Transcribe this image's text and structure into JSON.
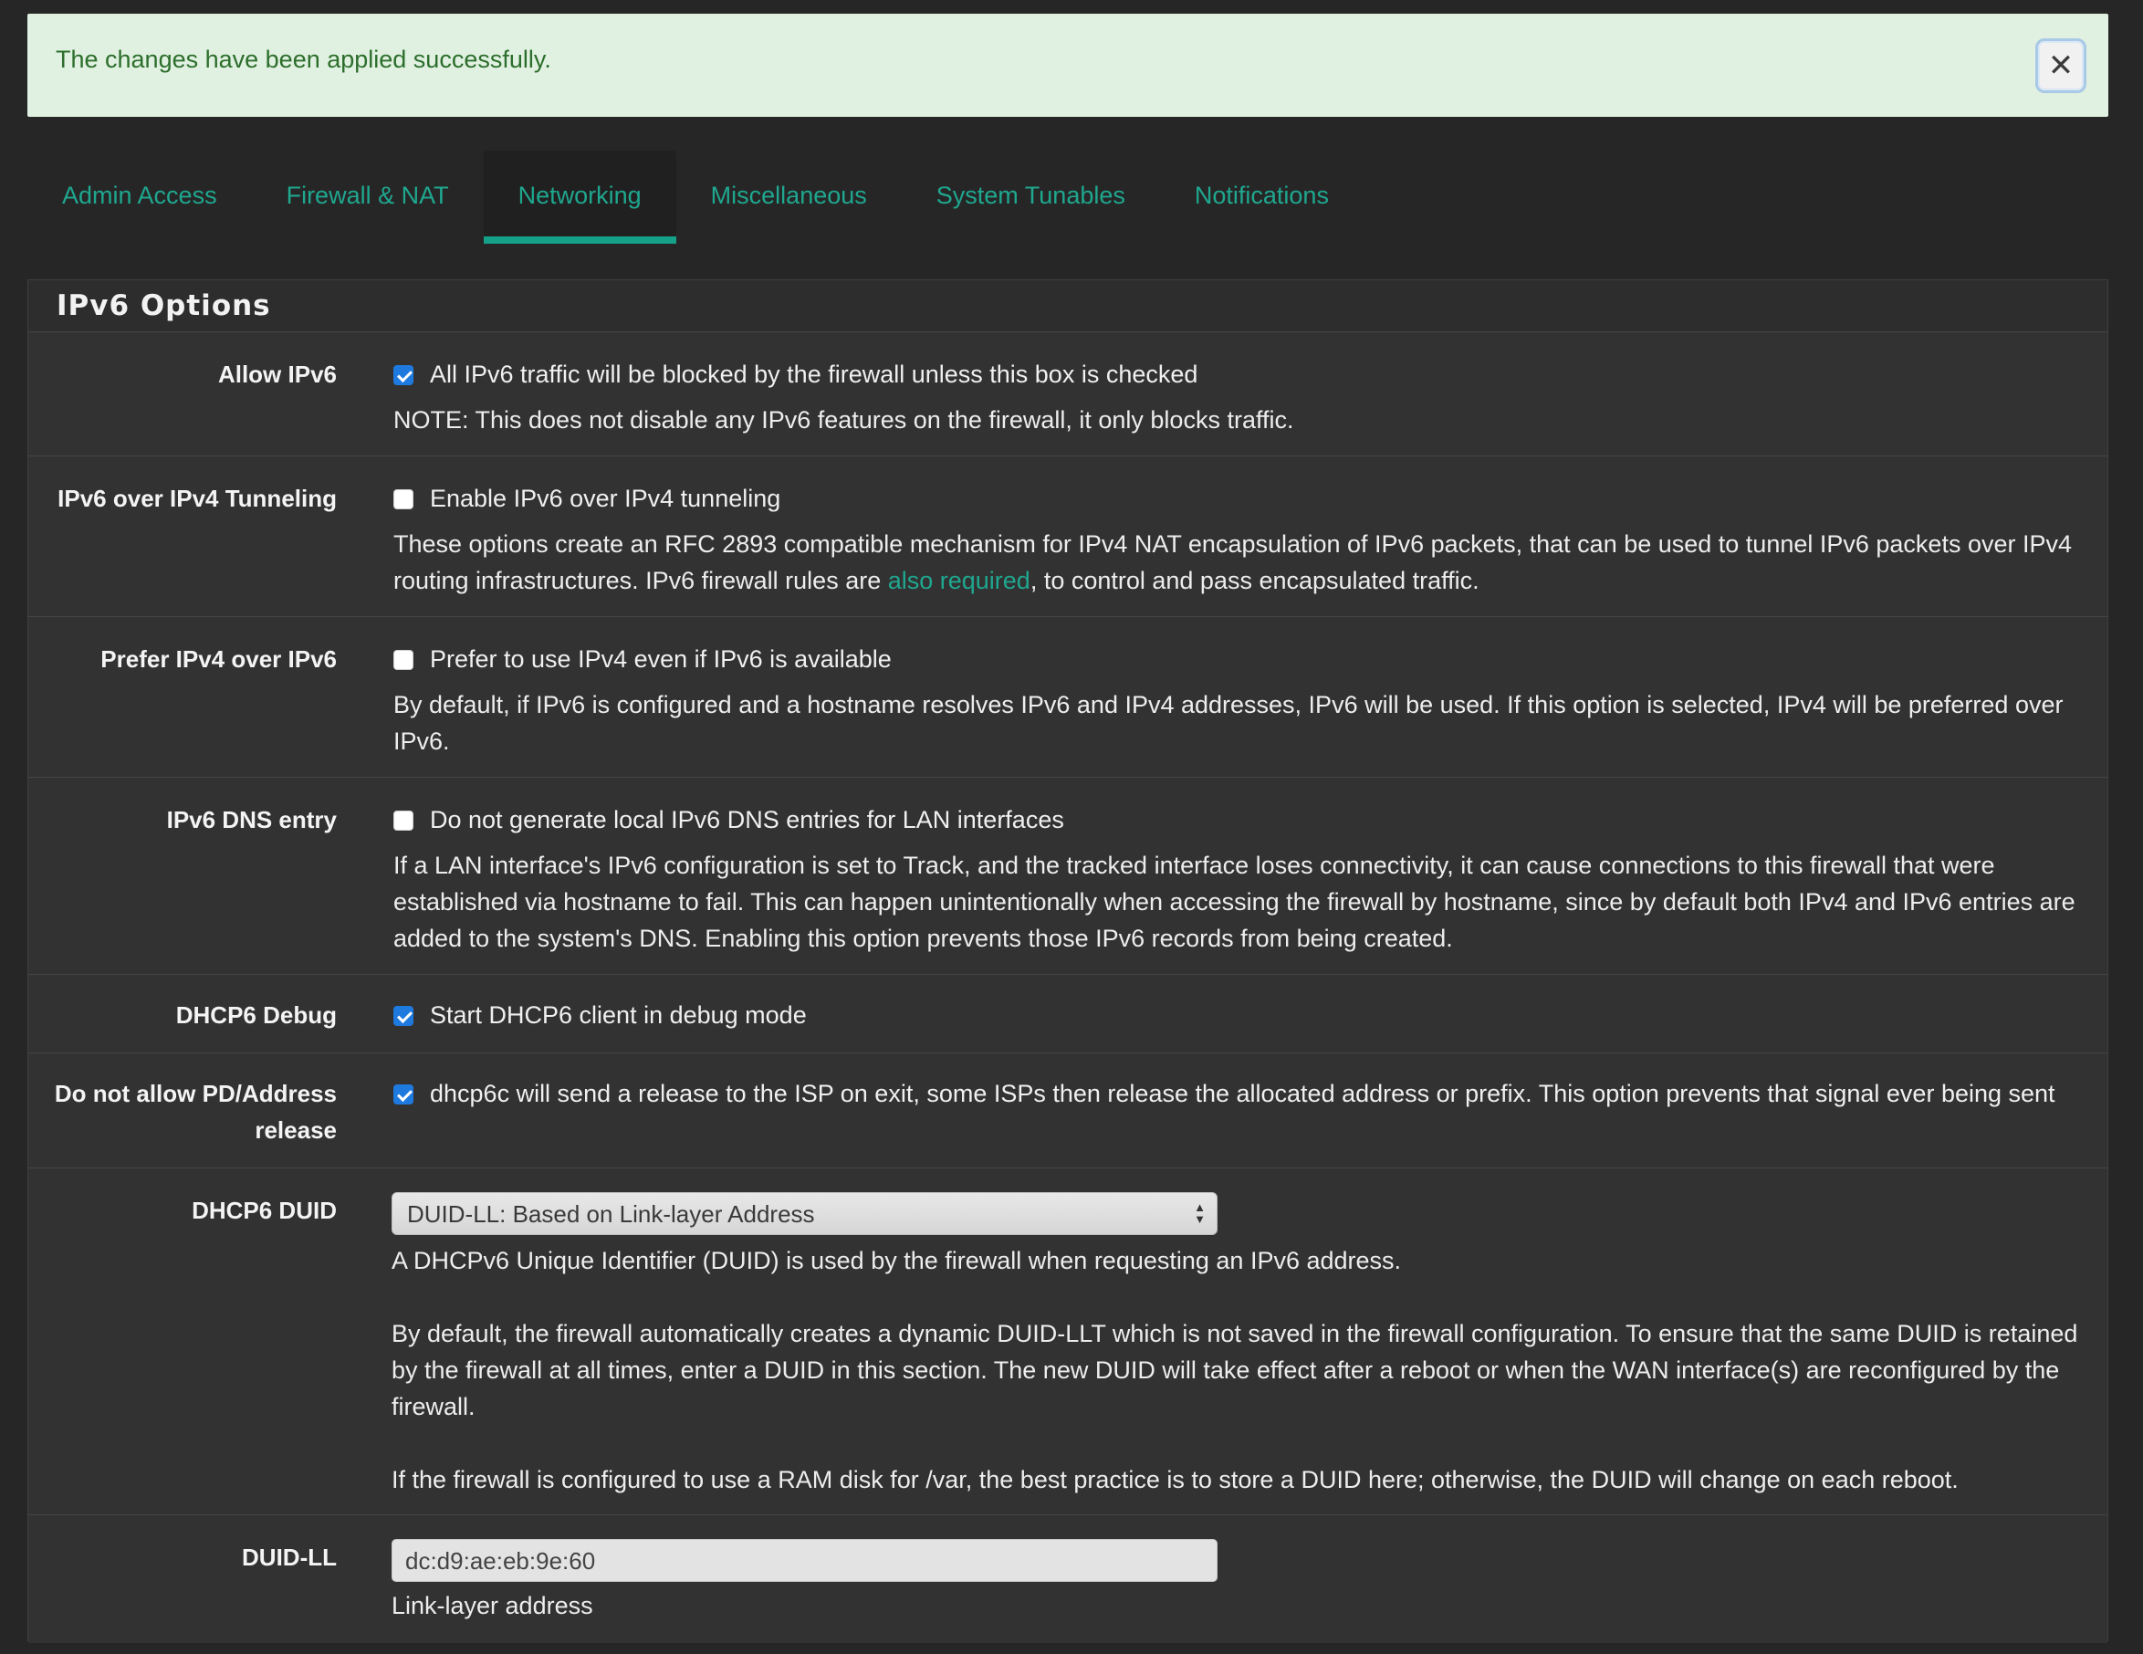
{
  "alert": {
    "message": "The changes have been applied successfully.",
    "close_symbol": "✕"
  },
  "tabs": [
    {
      "label": "Admin Access",
      "active": false
    },
    {
      "label": "Firewall & NAT",
      "active": false
    },
    {
      "label": "Networking",
      "active": true
    },
    {
      "label": "Miscellaneous",
      "active": false
    },
    {
      "label": "System Tunables",
      "active": false
    },
    {
      "label": "Notifications",
      "active": false
    }
  ],
  "panel": {
    "title": "IPv6 Options"
  },
  "rows": {
    "allow_ipv6": {
      "label": "Allow IPv6",
      "checked": true,
      "checkbox_text": "All IPv6 traffic will be blocked by the firewall unless this box is checked",
      "help": "NOTE: This does not disable any IPv6 features on the firewall, it only blocks traffic."
    },
    "tunneling": {
      "label": "IPv6 over IPv4 Tunneling",
      "checked": false,
      "checkbox_text": "Enable IPv6 over IPv4 tunneling",
      "help_before": "These options create an RFC 2893 compatible mechanism for IPv4 NAT encapsulation of IPv6 packets, that can be used to tunnel IPv6 packets over IPv4 routing infrastructures. IPv6 firewall rules are ",
      "help_link": "also required",
      "help_after": ", to control and pass encapsulated traffic."
    },
    "prefer_ipv4": {
      "label": "Prefer IPv4 over IPv6",
      "checked": false,
      "checkbox_text": "Prefer to use IPv4 even if IPv6 is available",
      "help": "By default, if IPv6 is configured and a hostname resolves IPv6 and IPv4 addresses, IPv6 will be used. If this option is selected, IPv4 will be preferred over IPv6."
    },
    "dns_entry": {
      "label": "IPv6 DNS entry",
      "checked": false,
      "checkbox_text": "Do not generate local IPv6 DNS entries for LAN interfaces",
      "help": "If a LAN interface's IPv6 configuration is set to Track, and the tracked interface loses connectivity, it can cause connections to this firewall that were established via hostname to fail. This can happen unintentionally when accessing the firewall by hostname, since by default both IPv4 and IPv6 entries are added to the system's DNS. Enabling this option prevents those IPv6 records from being created."
    },
    "dhcp6_debug": {
      "label": "DHCP6 Debug",
      "checked": true,
      "checkbox_text": "Start DHCP6 client in debug mode"
    },
    "pd_release": {
      "label_line1": "Do not allow PD/Address",
      "label_line2": "release",
      "checked": true,
      "checkbox_text": "dhcp6c will send a release to the ISP on exit, some ISPs then release the allocated address or prefix. This option prevents that signal ever being sent"
    },
    "dhcp6_duid": {
      "label": "DHCP6 DUID",
      "selected": "DUID-LL: Based on Link-layer Address",
      "help1": "A DHCPv6 Unique Identifier (DUID) is used by the firewall when requesting an IPv6 address.",
      "help2": "By default, the firewall automatically creates a dynamic DUID-LLT which is not saved in the firewall configuration. To ensure that the same DUID is retained by the firewall at all times, enter a DUID in this section. The new DUID will take effect after a reboot or when the WAN interface(s) are reconfigured by the firewall.",
      "help3": "If the firewall is configured to use a RAM disk for /var, the best practice is to store a DUID here; otherwise, the DUID will change on each reboot."
    },
    "duid_ll": {
      "label": "DUID-LL",
      "value": "dc:d9:ae:eb:9e:60",
      "help": "Link-layer address"
    }
  },
  "colors": {
    "accent": "#1fa78f",
    "alert_bg": "#e1f1e1",
    "alert_text": "#2c6e2c",
    "checkbox_on": "#1f7ae0"
  }
}
